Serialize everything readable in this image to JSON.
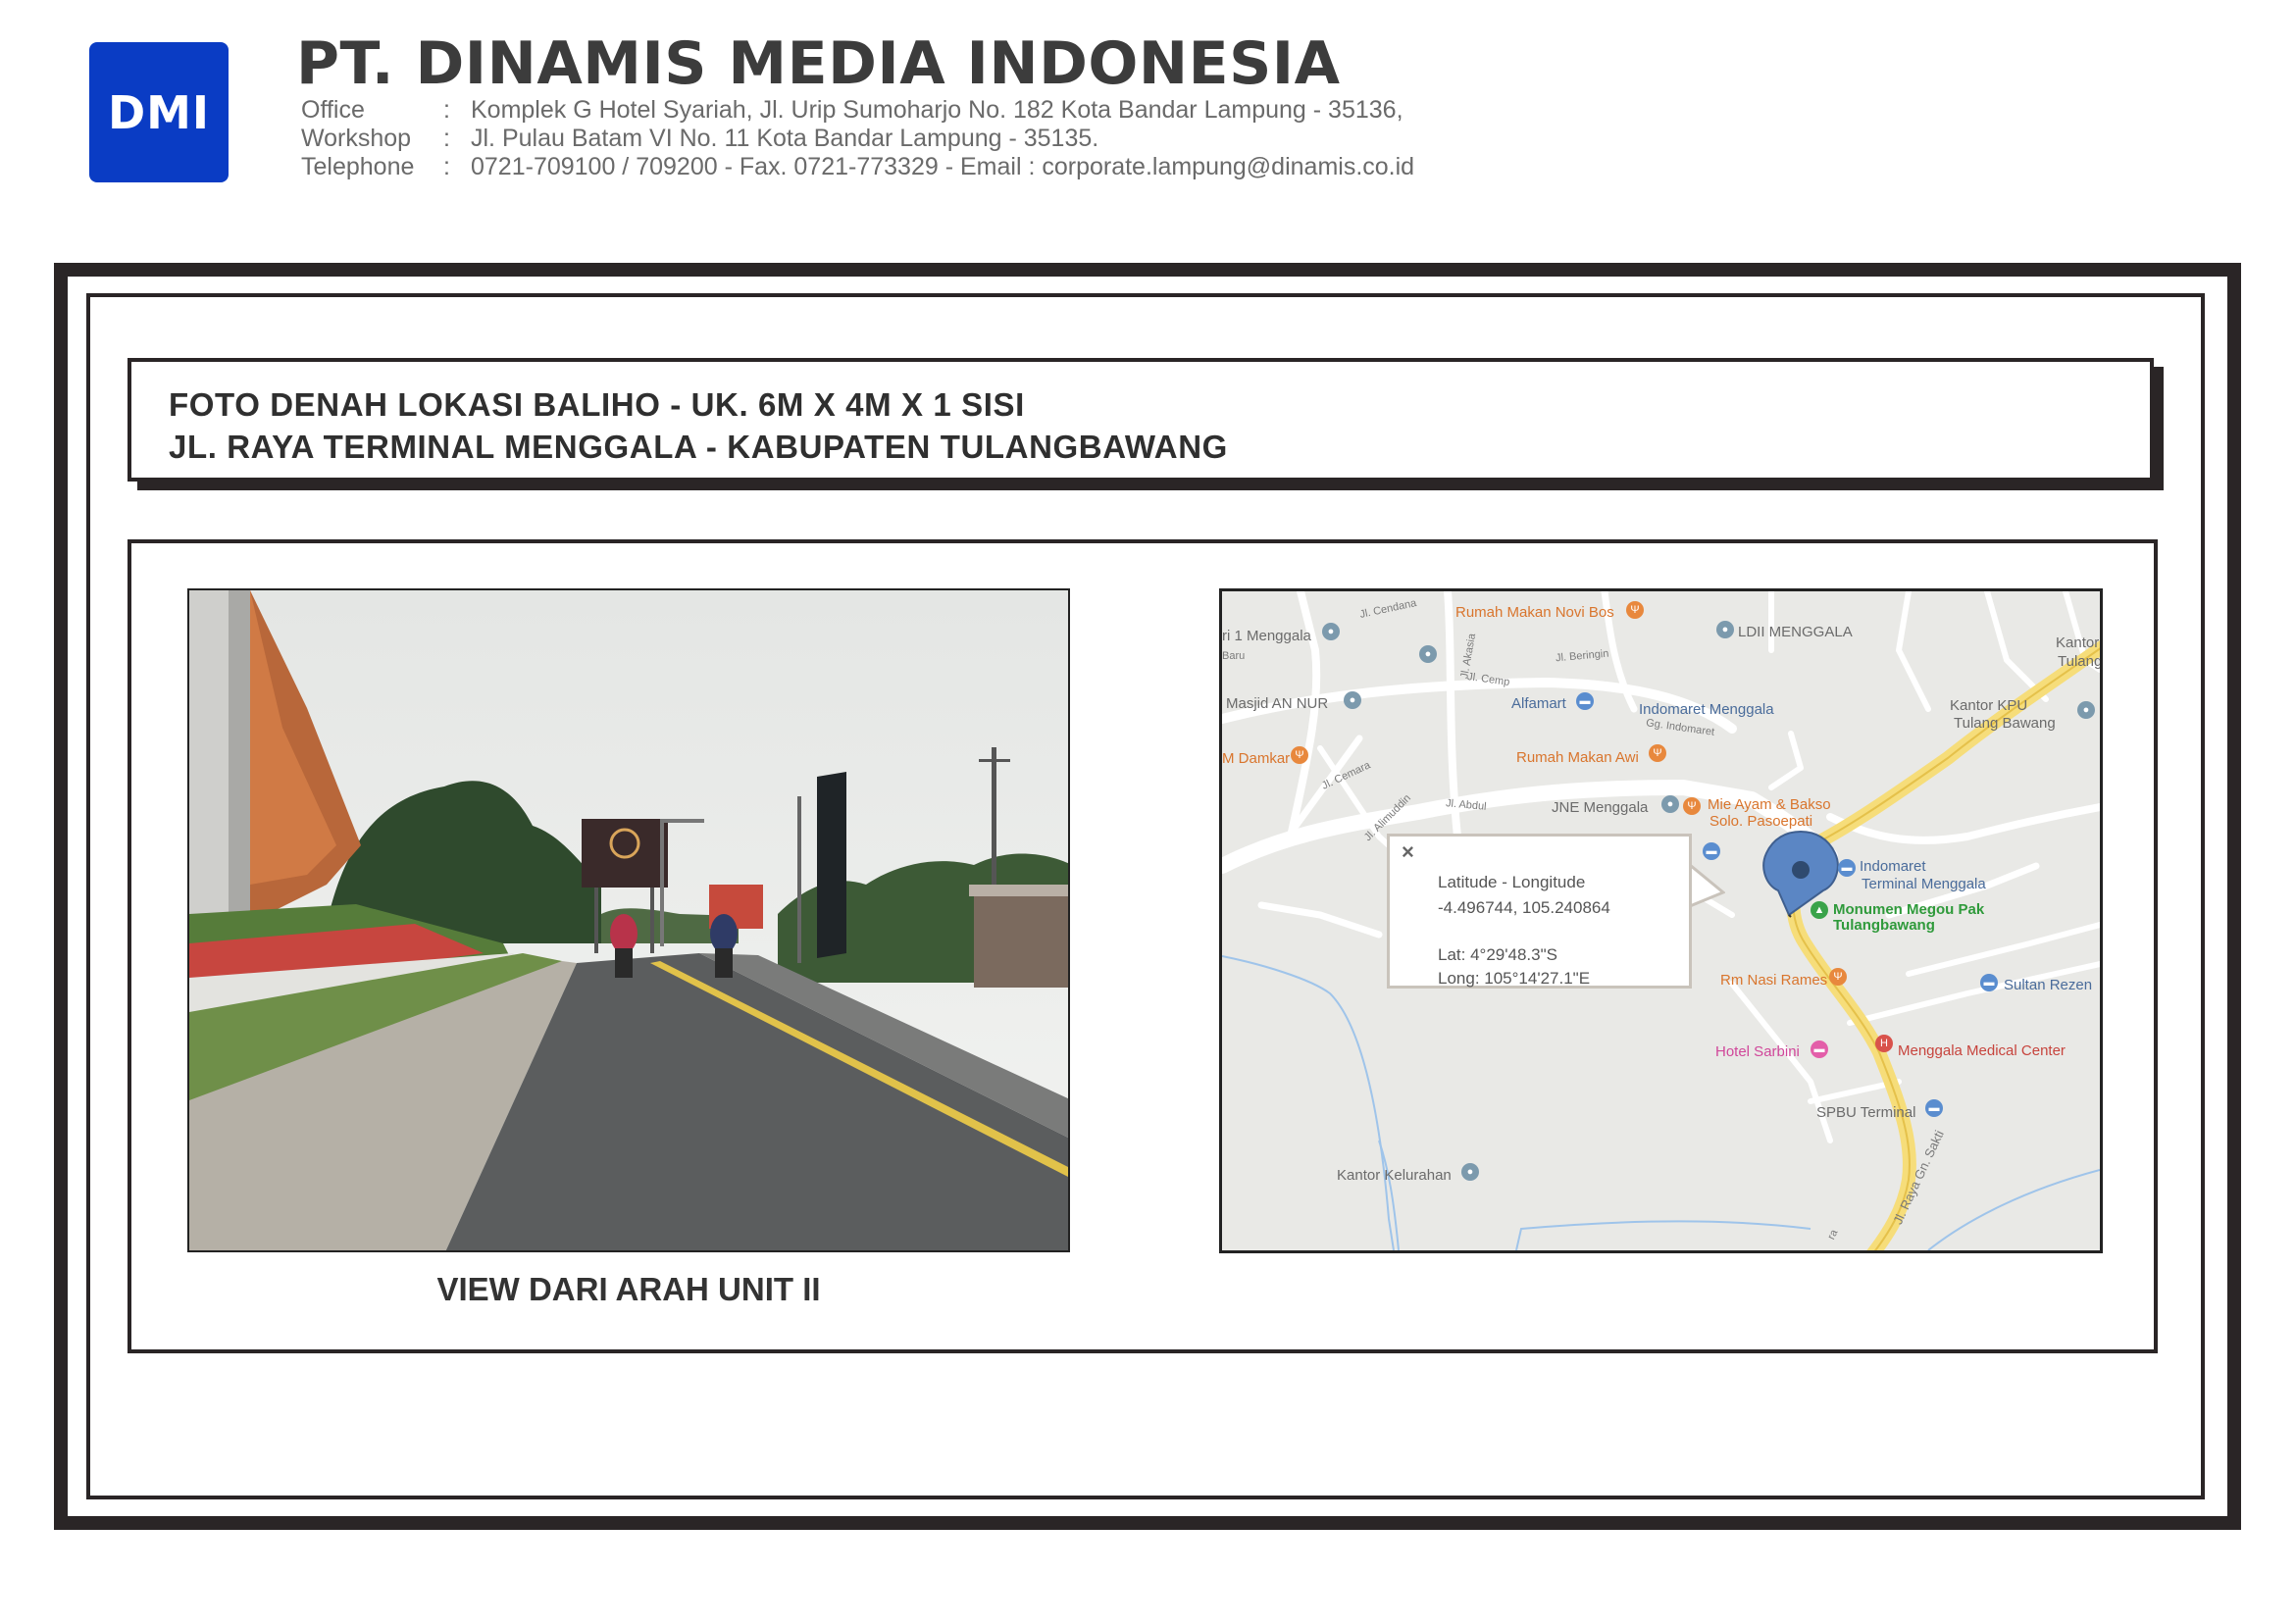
{
  "letterhead": {
    "logo_text": "DMI",
    "logo_color": "#0a3cc4",
    "company_name": "PT. DINAMIS MEDIA INDONESIA",
    "contacts": [
      {
        "key": "Office",
        "sep": ":",
        "value": "Komplek G Hotel Syariah, Jl. Urip  Sumoharjo No. 182 Kota Bandar Lampung - 35136,"
      },
      {
        "key": "Workshop",
        "sep": ":",
        "value": "Jl. Pulau Batam  VI  No. 11 Kota Bandar Lampung - 35135."
      },
      {
        "key": "Telephone",
        "sep": ":",
        "value": "0721-709100 / 709200 - Fax. 0721-773329 - Email : corporate.lampung@dinamis.co.id"
      }
    ]
  },
  "title": {
    "line1": "FOTO DENAH LOKASI BALIHO - UK. 6M X 4M X 1 SISI",
    "line2": "JL. RAYA TERMINAL MENGGALA - KABUPATEN TULANGBAWANG"
  },
  "photo": {
    "caption": "VIEW DARI ARAH UNIT II"
  },
  "map": {
    "accent_pin_color": "#5b86c4",
    "road_color": "#f4d56a",
    "pois": {
      "rm_novi": "Rumah Makan Novi Bos",
      "ldii": "LDII MENGGALA",
      "kantor_d": "Kantor D",
      "tulang_ba": "Tulang Ba",
      "ri_menggala": "ri 1 Menggala",
      "masjid": "Masjid AN NUR",
      "alfamart": "Alfamart",
      "indomaret": "Indomaret Menggala",
      "kantor_kpu_1": "Kantor KPU",
      "kantor_kpu_2": "Tulang Bawang",
      "damkar": "M Damkar",
      "rm_awi": "Rumah Makan Awi",
      "jne": "JNE Menggala",
      "mie_1": "Mie Ayam & Bakso",
      "mie_2": "Solo. Pasoepati",
      "indomaret_t1": "Indomaret",
      "indomaret_t2": "Terminal Menggala",
      "monumen_1": "Monumen Megou Pak",
      "monumen_2": "Tulangbawang",
      "rm_nasi": "Rm Nasi Rames",
      "sultan": "Sultan Rezen",
      "hotel": "Hotel Sarbini",
      "medical": "Menggala Medical Center",
      "spbu": "SPBU Terminal",
      "kelurahan": "Kantor Kelurahan"
    },
    "streets": {
      "cendana": "Jl. Cendana",
      "baru": "Baru",
      "akasia": "Jl. Akasia",
      "beringin": "Jl. Beringin",
      "cemp": "Jl. Cemp",
      "gg_indomaret": "Gg. Indomaret",
      "cemara": "Jl. Cemara",
      "abdul": "Jl. Abdul",
      "alimuddin": "Jl. Alimuddin",
      "raya_gn_sakti": "Jl. Raya Gn. Sakti",
      "ra": "ra"
    },
    "popup": {
      "close": "×",
      "label": "Latitude - Longitude",
      "coords": "-4.496744, 105.240864",
      "lat": "Lat: 4°29'48.3\"S",
      "long": "Long: 105°14'27.1\"E"
    }
  }
}
